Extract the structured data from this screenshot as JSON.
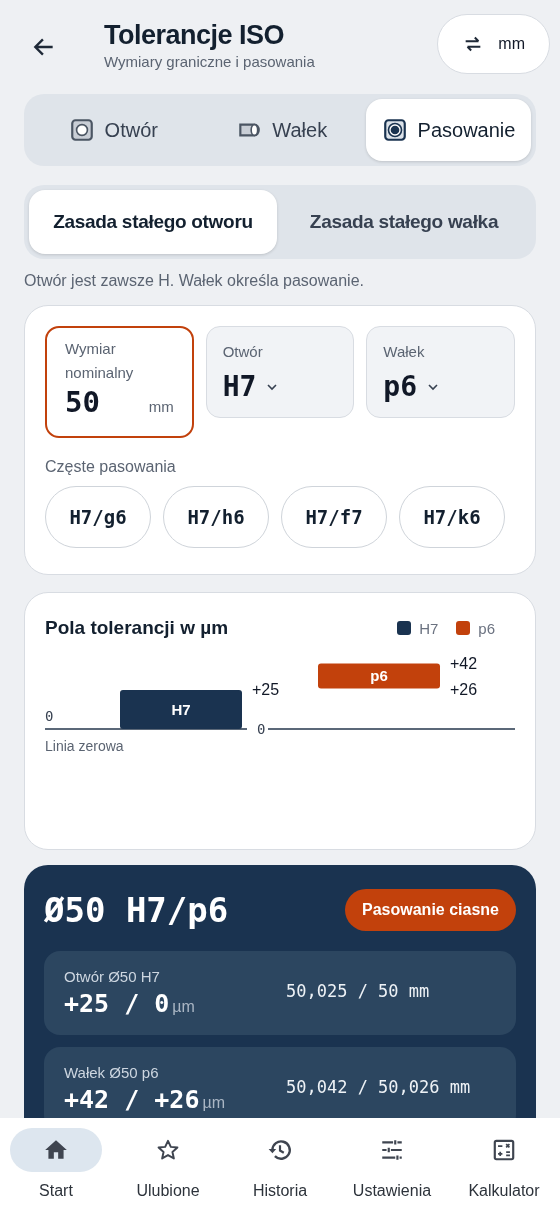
{
  "header": {
    "title": "Tolerancje ISO",
    "subtitle": "Wymiary graniczne i pasowania",
    "unit_button": "mm"
  },
  "mode_tabs": [
    {
      "label": "Otwór",
      "kind": "hole",
      "selected": false
    },
    {
      "label": "Wałek",
      "kind": "shaft",
      "selected": false
    },
    {
      "label": "Pasowanie",
      "kind": "fit",
      "selected": true
    }
  ],
  "system_tabs": [
    {
      "label": "Zasada stałego otworu",
      "selected": true
    },
    {
      "label": "Zasada stałego wałka",
      "selected": false
    }
  ],
  "note": "Otwór jest zawsze H. Wałek określa pasowanie.",
  "inputs": {
    "nominal": {
      "label": "Wymiar nominalny",
      "value": "50",
      "unit": "mm",
      "focused": true
    },
    "selects": [
      {
        "label": "Otwór",
        "value": "H7"
      },
      {
        "label": "Wałek",
        "value": "p6"
      }
    ],
    "common_label": "Częste pasowania",
    "common_fits": [
      "H7/g6",
      "H7/h6",
      "H7/f7",
      "H7/k6"
    ]
  },
  "diagram": {
    "title": "Pola tolerancji w µm",
    "zero_value": "0",
    "zero_label": "Linia zerowa",
    "legend": [
      {
        "label": "H7",
        "color": "#1a3350"
      },
      {
        "label": "p6",
        "color": "#c2410c"
      }
    ],
    "zones": [
      {
        "label": "H7",
        "color": "#1a3350",
        "upper": "+25",
        "lower": "0"
      },
      {
        "label": "p6",
        "color": "#c2410c",
        "upper": "+42",
        "lower": "+26"
      }
    ]
  },
  "result": {
    "title": "Ø50 H7/p6",
    "badge": "Pasowanie ciasne",
    "rows": [
      {
        "label": "Otwór Ø50 H7",
        "deviations": "+25 / 0",
        "unit": "µm",
        "limits": "50,025 / 50 mm"
      },
      {
        "label": "Wałek Ø50 p6",
        "deviations": "+42 / +26",
        "unit": "µm",
        "limits": "50,042 / 50,026 mm"
      }
    ]
  },
  "nav": [
    {
      "label": "Start",
      "kind": "home",
      "selected": true
    },
    {
      "label": "Ulubione",
      "kind": "star",
      "selected": false
    },
    {
      "label": "Historia",
      "kind": "history",
      "selected": false
    },
    {
      "label": "Ustawienia",
      "kind": "tune",
      "selected": false
    },
    {
      "label": "Kalkulator",
      "kind": "calculator",
      "selected": false
    }
  ]
}
